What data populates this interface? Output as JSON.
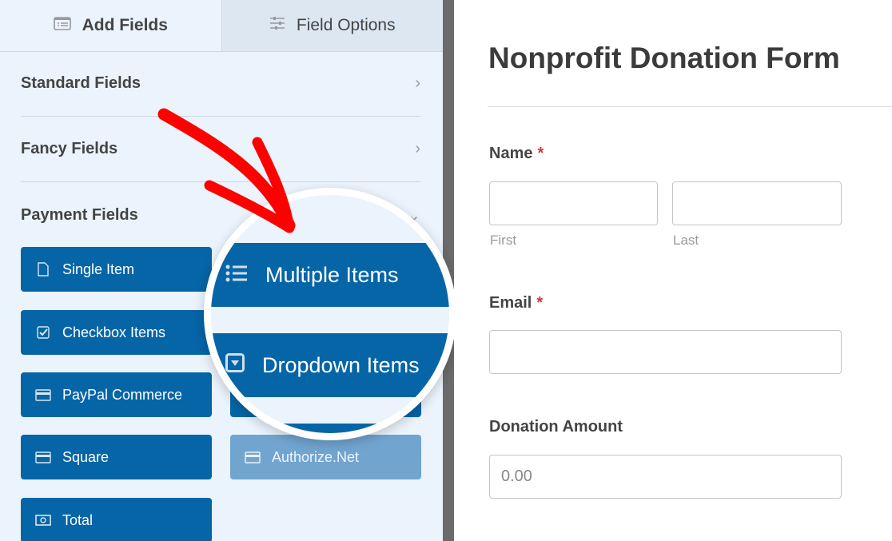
{
  "tabs": {
    "add_fields": "Add Fields",
    "field_options": "Field Options"
  },
  "sections": [
    {
      "label": "Standard Fields",
      "state": "collapsed"
    },
    {
      "label": "Fancy Fields",
      "state": "collapsed"
    },
    {
      "label": "Payment Fields",
      "state": "expanded"
    }
  ],
  "payment_buttons": [
    {
      "label": "Single Item",
      "icon": "file-icon"
    },
    {
      "label": "Checkbox Items",
      "icon": "checkbox-icon"
    },
    {
      "label": "PayPal Commerce",
      "icon": "credit-card-icon"
    },
    {
      "label": "Square",
      "icon": "credit-card-icon"
    },
    {
      "label": "Authorize.Net",
      "icon": "credit-card-icon",
      "disabled": true
    },
    {
      "label": "Total",
      "icon": "money-icon"
    }
  ],
  "magnifier": {
    "items": [
      {
        "label": "Multiple Items",
        "icon": "list-icon"
      },
      {
        "label": "Dropdown Items",
        "icon": "dropdown-icon"
      }
    ]
  },
  "form": {
    "title": "Nonprofit Donation Form",
    "name_label": "Name",
    "required_mark": "*",
    "first_sub": "First",
    "last_sub": "Last",
    "email_label": "Email",
    "donation_label": "Donation Amount",
    "donation_placeholder": "0.00"
  },
  "colors": {
    "accent": "#0565a7",
    "disabled": "#71a5d0",
    "arrow": "#ff0000",
    "required": "#d63638"
  }
}
